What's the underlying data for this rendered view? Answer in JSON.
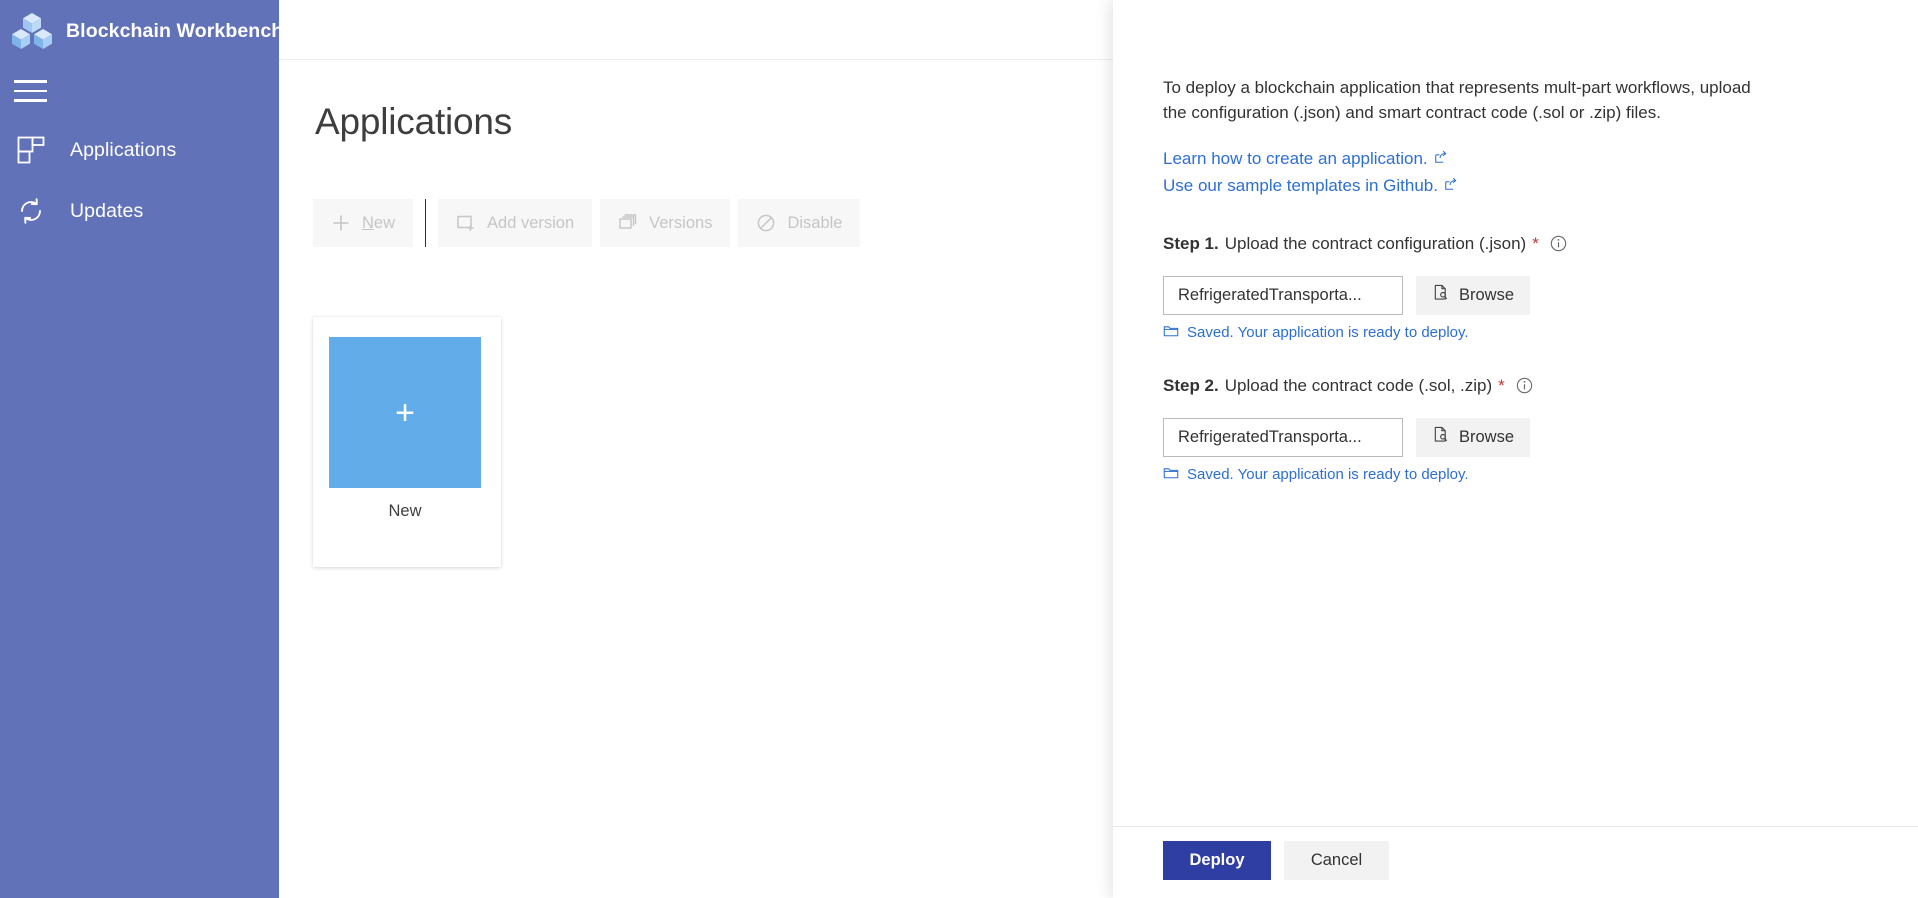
{
  "sidebar": {
    "brand_title": "Blockchain Workbench",
    "logo_icon": "blockchain-cubes-logo",
    "menu_icon": "hamburger-menu-icon",
    "background_color": "#6272b8",
    "items": [
      {
        "label": "Applications",
        "icon": "applications-grid-icon"
      },
      {
        "label": "Updates",
        "icon": "refresh-sync-icon"
      }
    ]
  },
  "main": {
    "page_title": "Applications",
    "toolbar": [
      {
        "label_prefix": "",
        "accesskey": "N",
        "label_suffix": "ew",
        "label": "New",
        "icon": "plus-icon",
        "disabled": true
      },
      {
        "label": "Add version",
        "icon": "add-version-icon",
        "disabled": true
      },
      {
        "label": "Versions",
        "icon": "versions-stack-icon",
        "disabled": true
      },
      {
        "label": "Disable",
        "icon": "disable-circle-slash-icon",
        "disabled": true
      }
    ],
    "tile": {
      "label": "New",
      "plus_glyph": "+",
      "tile_color": "#62acea"
    }
  },
  "panel": {
    "close_icon": "close-icon",
    "intro": "To deploy a blockchain application that represents mult-part workflows, upload the configuration (.json) and smart contract code (.sol or .zip) files.",
    "links": [
      {
        "text": "Learn how to create an application.",
        "icon": "external-link-icon"
      },
      {
        "text": "Use our sample templates in Github.",
        "icon": "external-link-icon"
      }
    ],
    "link_color": "#2d6fd0",
    "steps": [
      {
        "number": "Step 1.",
        "description": "Upload the contract configuration (.json)",
        "required_mark": "*",
        "info_icon": "info-circle-icon",
        "input_value": "RefrigeratedTransporta...",
        "input_placeholder": "",
        "browse_label": "Browse",
        "browse_icon": "file-browse-icon",
        "status_text": "Saved. Your application is ready to deploy.",
        "status_icon": "folder-icon"
      },
      {
        "number": "Step 2.",
        "description": "Upload the contract code (.sol, .zip)",
        "required_mark": "*",
        "info_icon": "info-circle-icon",
        "input_value": "RefrigeratedTransporta...",
        "input_placeholder": "",
        "browse_label": "Browse",
        "browse_icon": "file-browse-icon",
        "status_text": "Saved. Your application is ready to deploy.",
        "status_icon": "folder-icon"
      }
    ],
    "footer": {
      "deploy_label": "Deploy",
      "cancel_label": "Cancel",
      "deploy_color": "#2f3ea3"
    }
  }
}
